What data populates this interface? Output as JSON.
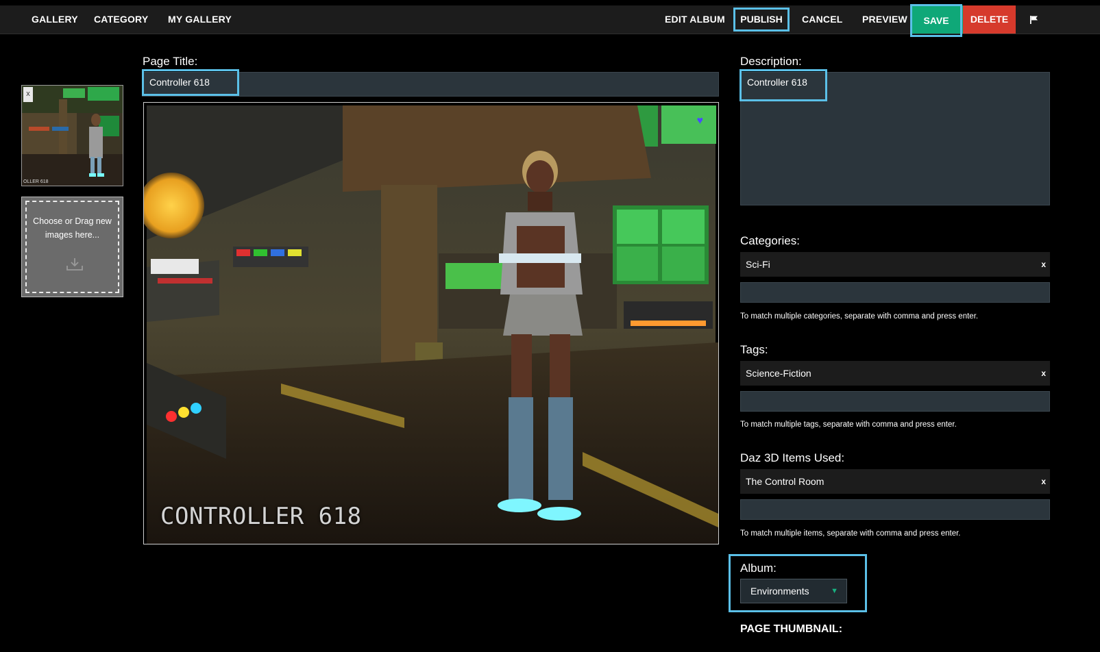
{
  "nav": {
    "gallery": "GALLERY",
    "category": "CATEGORY",
    "my_gallery": "MY GALLERY",
    "edit_album": "EDIT ALBUM",
    "publish": "PUBLISH",
    "cancel": "CANCEL",
    "preview": "PREVIEW",
    "save": "SAVE",
    "delete": "DELETE",
    "flag_icon": "flag-icon"
  },
  "colors": {
    "save": "#0fa878",
    "delete": "#d63a2c",
    "highlight": "#5bc0e8",
    "field": "#2b353c",
    "select_arrow": "#18b080"
  },
  "sidebar": {
    "thumb_close": "x",
    "thumb_caption": "OLLER 618",
    "dropzone_text": "Choose or Drag new images here...",
    "dropzone_icon": "download-icon"
  },
  "page_title": {
    "label": "Page Title:",
    "value": "Controller 618"
  },
  "main_image": {
    "caption": "CONTROLLER 618",
    "favorite_icon": "heart-icon"
  },
  "description": {
    "label": "Description:",
    "value": "Controller 618"
  },
  "categories": {
    "label": "Categories:",
    "tag": "Sci-Fi",
    "remove": "x",
    "hint": "To match multiple categories, separate with comma and press enter."
  },
  "tags": {
    "label": "Tags:",
    "tag": "Science-Fiction",
    "remove": "x",
    "hint": "To match multiple tags, separate with comma and press enter."
  },
  "daz_items": {
    "label": "Daz 3D Items Used:",
    "tag": "The Control Room",
    "remove": "x",
    "hint": "To match multiple items, separate with comma and press enter."
  },
  "album": {
    "label": "Album:",
    "selected": "Environments"
  },
  "page_thumbnail": {
    "label": "PAGE THUMBNAIL:"
  }
}
